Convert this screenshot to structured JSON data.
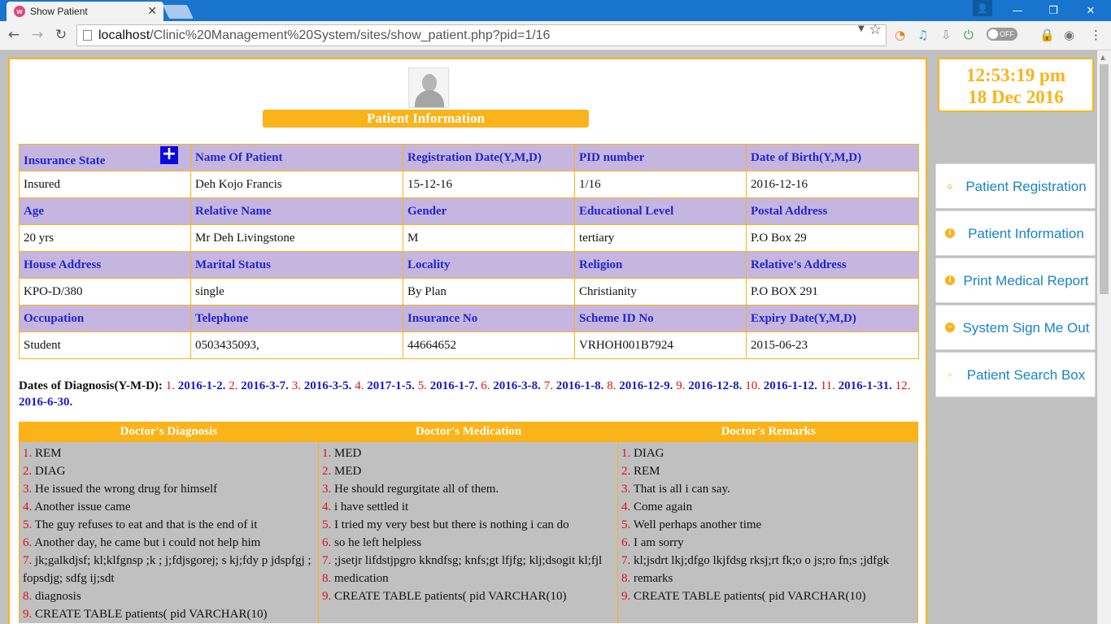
{
  "browser": {
    "tab_title": "Show Patient",
    "url_host": "localhost",
    "url_path": "/Clinic%20Management%20System/sites/show_patient.php?pid=1/16",
    "toggle_label": "OFF"
  },
  "page": {
    "banner": "Patient Information",
    "plus_symbol": "+",
    "info_rows": [
      {
        "headers": [
          "Insurance State",
          "Name Of Patient",
          "Registration Date(Y,M,D)",
          "PID number",
          "Date of Birth(Y,M,D)"
        ],
        "values": [
          "Insured",
          "Deh Kojo Francis",
          "15-12-16",
          "1/16",
          "2016-12-16"
        ]
      },
      {
        "headers": [
          "Age",
          "Relative Name",
          "Gender",
          "Educational Level",
          "Postal Address"
        ],
        "values": [
          "20 yrs",
          "Mr Deh Livingstone",
          "M",
          "tertiary",
          "P.O Box 29"
        ]
      },
      {
        "headers": [
          "House Address",
          "Marital Status",
          "Locality",
          "Religion",
          "Relative's Address"
        ],
        "values": [
          "KPO-D/380",
          "single",
          "By Plan",
          "Christianity",
          "P.O BOX 291"
        ]
      },
      {
        "headers": [
          "Occupation",
          "Telephone",
          "Insurance No",
          "Scheme ID No",
          "Expiry Date(Y,M,D)"
        ],
        "values": [
          "Student",
          "0503435093,",
          "44664652",
          "VRHOH001B7924",
          "2015-06-23"
        ]
      }
    ],
    "diagnosis_dates_label": "Dates of Diagnosis(Y-M-D):",
    "diagnosis_dates": [
      {
        "n": "1.",
        "d": "2016-1-2."
      },
      {
        "n": "2.",
        "d": "2016-3-7."
      },
      {
        "n": "3.",
        "d": "2016-3-5."
      },
      {
        "n": "4.",
        "d": "2017-1-5."
      },
      {
        "n": "5.",
        "d": "2016-1-7."
      },
      {
        "n": "6.",
        "d": "2016-3-8."
      },
      {
        "n": "7.",
        "d": "2016-1-8."
      },
      {
        "n": "8.",
        "d": "2016-12-9."
      },
      {
        "n": "9.",
        "d": "2016-12-8."
      },
      {
        "n": "10.",
        "d": "2016-1-12."
      },
      {
        "n": "11.",
        "d": "2016-1-31."
      },
      {
        "n": "12.",
        "d": "2016-6-30."
      }
    ],
    "doctor_columns": [
      {
        "header": "Doctor's Diagnosis",
        "items": [
          {
            "n": "1.",
            "t": "REM"
          },
          {
            "n": "2.",
            "t": "DIAG"
          },
          {
            "n": "3.",
            "t": "He issued the wrong drug for himself"
          },
          {
            "n": "4.",
            "t": "Another issue came"
          },
          {
            "n": "5.",
            "t": "The guy refuses to eat and that is the end of it"
          },
          {
            "n": "6.",
            "t": "Another day, he came but i could not help him"
          },
          {
            "n": "7.",
            "t": "jk;galkdjsf; kl;klfgnsp ;k ; j;fdjsgorej; s kj;fdy p jdspfgj ; fopsdjg; sdfg ij;sdt"
          },
          {
            "n": "8.",
            "t": "diagnosis"
          },
          {
            "n": "9.",
            "t": "CREATE TABLE patients( pid VARCHAR(10)"
          }
        ]
      },
      {
        "header": "Doctor's Medication",
        "items": [
          {
            "n": "1.",
            "t": "MED"
          },
          {
            "n": "2.",
            "t": "MED"
          },
          {
            "n": "3.",
            "t": "He should regurgitate all of them."
          },
          {
            "n": "4.",
            "t": "i have settled it"
          },
          {
            "n": "5.",
            "t": "I tried my very best but there is nothing i can do"
          },
          {
            "n": "6.",
            "t": "so he left helpless"
          },
          {
            "n": "7.",
            "t": ";jsetjr lifdstjpgro kkndfsg; knfs;gt lfjfg; klj;dsogit kl;fjl"
          },
          {
            "n": "8.",
            "t": "medication"
          },
          {
            "n": "9.",
            "t": "CREATE TABLE patients( pid VARCHAR(10)"
          }
        ]
      },
      {
        "header": "Doctor's Remarks",
        "items": [
          {
            "n": "1.",
            "t": "DIAG"
          },
          {
            "n": "2.",
            "t": "REM"
          },
          {
            "n": "3.",
            "t": "That is all i can say."
          },
          {
            "n": "4.",
            "t": "Come again"
          },
          {
            "n": "5.",
            "t": "Well perhaps another time"
          },
          {
            "n": "6.",
            "t": "I am sorry"
          },
          {
            "n": "7.",
            "t": "kl;jsdrt lkj;dfgo lkjfdsg rksj;rt fk;o o js;ro fn;s ;jdfgk"
          },
          {
            "n": "8.",
            "t": "remarks"
          },
          {
            "n": "9.",
            "t": "CREATE TABLE patients( pid VARCHAR(10)"
          }
        ]
      }
    ]
  },
  "sidebar": {
    "clock_time": "12:53:19 pm",
    "clock_date": "18 Dec 2016",
    "menu": [
      {
        "label": "Patient Registration",
        "icon": "home-icon",
        "glyph": "⌂"
      },
      {
        "label": "Patient Information",
        "icon": "info-icon",
        "glyph": "i"
      },
      {
        "label": "Print Medical Report",
        "icon": "info-icon",
        "glyph": "i"
      },
      {
        "label": "System Sign Me Out",
        "icon": "minus-circle-icon",
        "glyph": "−"
      },
      {
        "label": "Patient Search Box",
        "icon": "search-icon",
        "glyph": "⌕"
      }
    ]
  },
  "colors": {
    "accent": "#fab319",
    "header_bg": "#c5b6e0",
    "header_text": "#2424c8",
    "link_blue": "#1784c7",
    "number_red": "#e01010"
  }
}
